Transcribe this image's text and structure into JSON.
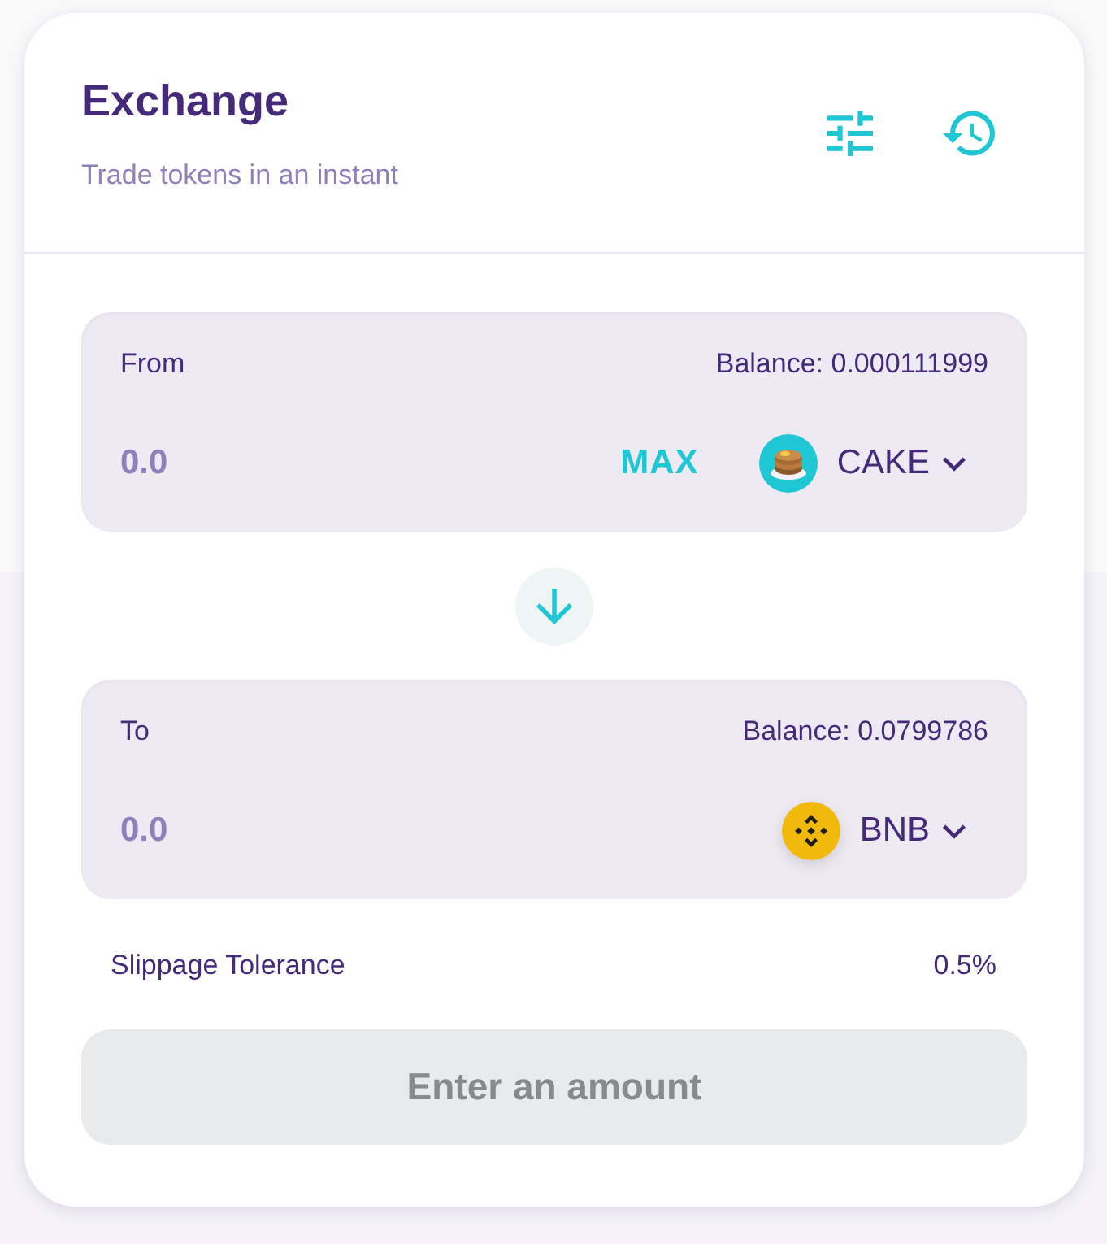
{
  "header": {
    "title": "Exchange",
    "subtitle": "Trade tokens in an instant"
  },
  "panels": [
    {
      "label": "From",
      "balance": "Balance: 0.000111999",
      "placeholder": "0.0",
      "max_button": "MAX",
      "token": {
        "symbol": "CAKE",
        "kind": "cake"
      }
    },
    {
      "label": "To",
      "balance": "Balance: 0.0799786",
      "placeholder": "0.0",
      "token": {
        "symbol": "BNB",
        "kind": "bnb"
      }
    }
  ],
  "slippage": {
    "label": "Slippage Tolerance",
    "value": "0.5%"
  },
  "submit_button": {
    "label": "Enter an amount",
    "disabled": true
  }
}
